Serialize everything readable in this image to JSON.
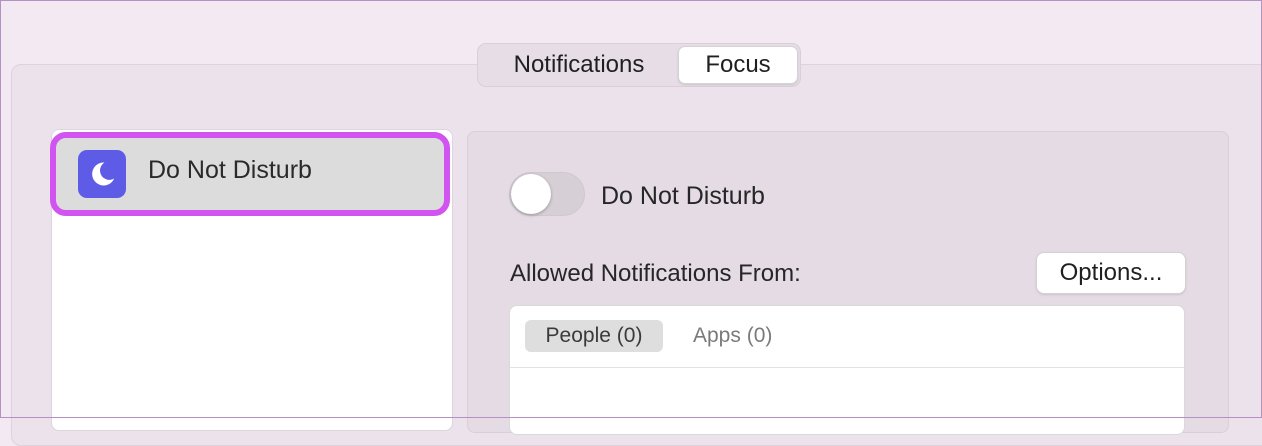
{
  "segmented_control": {
    "notifications_label": "Notifications",
    "focus_label": "Focus",
    "selected": "Focus"
  },
  "focus_list": {
    "items": [
      {
        "label": "Do Not Disturb",
        "icon": "moon-icon",
        "icon_color": "#5e5ce6",
        "selected": true
      }
    ]
  },
  "detail": {
    "toggle": {
      "label": "Do Not Disturb",
      "on": false
    },
    "allowed_label": "Allowed Notifications From:",
    "options_label": "Options...",
    "tabs": [
      {
        "label": "People (0)",
        "selected": true
      },
      {
        "label": "Apps (0)",
        "selected": false
      }
    ]
  },
  "colors": {
    "highlight_outline": "#d153f0",
    "accent_moon": "#5e5ce6",
    "window_bg": "#f2e9f2"
  }
}
